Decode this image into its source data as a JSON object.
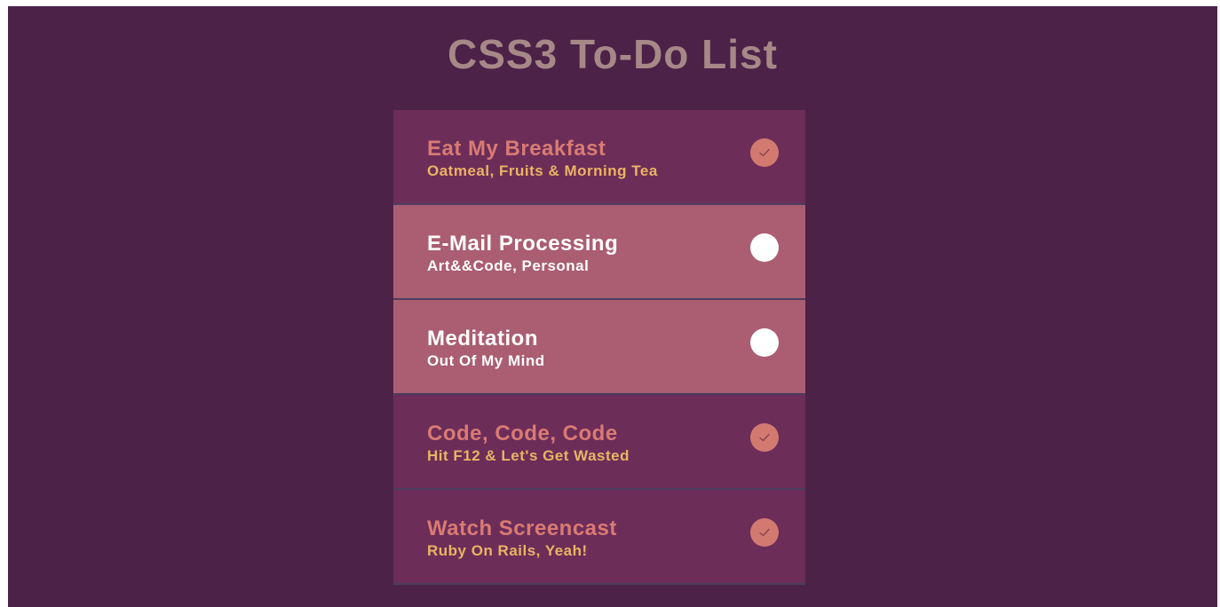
{
  "page": {
    "title": "CSS3 To-Do List"
  },
  "colors": {
    "background": "#4c2249",
    "title": "#a68887",
    "done_row": "#6c2d59",
    "pending_row": "#ab5d71",
    "done_title": "#d97b73",
    "done_subtitle": "#e9b463",
    "check_circle": "#d37a70",
    "pending_circle": "#ffffff"
  },
  "todos": [
    {
      "title": "Eat My Breakfast",
      "subtitle": "Oatmeal, Fruits & Morning Tea",
      "done": true,
      "icon": "check-icon"
    },
    {
      "title": "E-Mail Processing",
      "subtitle": "Art&&Code, Personal",
      "done": false,
      "icon": "empty-circle-icon"
    },
    {
      "title": "Meditation",
      "subtitle": "Out Of My Mind",
      "done": false,
      "icon": "empty-circle-icon"
    },
    {
      "title": "Code, Code, Code",
      "subtitle": "Hit F12 & Let's Get Wasted",
      "done": true,
      "icon": "check-icon"
    },
    {
      "title": "Watch Screencast",
      "subtitle": "Ruby On Rails, Yeah!",
      "done": true,
      "icon": "check-icon"
    }
  ]
}
